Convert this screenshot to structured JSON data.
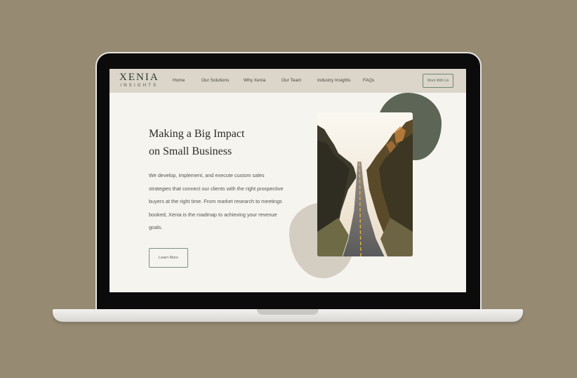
{
  "site": {
    "logo": {
      "main": "XENIA",
      "sub": "INSIGHTS"
    },
    "nav": [
      "Home",
      "Our Solutions",
      "Why Xenia",
      "Our Team",
      "Industry Insights",
      "FAQs"
    ],
    "cta": "Work With Us"
  },
  "hero": {
    "title_line1": "Making a Big Impact",
    "title_line2": "on Small Business",
    "text": "We develop, implement, and execute custom sales strategies that connect our clients with the right prospective buyers at the right time. From market research to meetings booked, Xenia is the roadmap to achieving your revenue goals.",
    "button": "Learn More"
  },
  "colors": {
    "background": "#968a73",
    "nav": "#dbd5ca",
    "screen": "#f6f4ef",
    "accent_green": "#5c6556",
    "blob_light": "#d4cdc2"
  },
  "icons": [
    "road-photo"
  ]
}
